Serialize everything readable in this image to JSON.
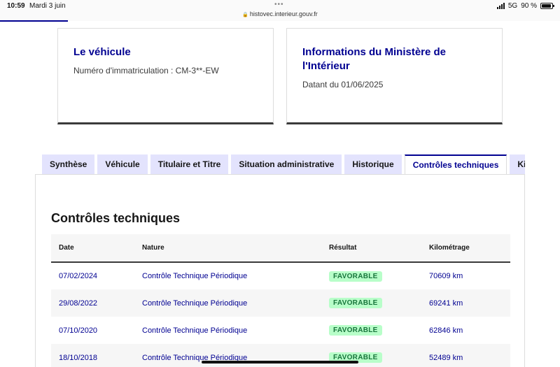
{
  "status_bar": {
    "time": "10:59",
    "date": "Mardi 3 juin",
    "url": "histovec.interieur.gouv.fr",
    "network": "5G",
    "battery": "90 %",
    "battery_level": 0.9
  },
  "cards": [
    {
      "title": "Le véhicule",
      "text": "Numéro d'immatriculation : CM-3**-EW"
    },
    {
      "title": "Informations du Ministère de l'Intérieur",
      "text": "Datant du 01/06/2025"
    }
  ],
  "tabs": [
    {
      "label": "Synthèse"
    },
    {
      "label": "Véhicule"
    },
    {
      "label": "Titulaire et Titre"
    },
    {
      "label": "Situation administrative"
    },
    {
      "label": "Historique"
    },
    {
      "label": "Contrôles techniques"
    },
    {
      "label": "Kilométrage"
    }
  ],
  "active_tab": "Contrôles techniques",
  "section": {
    "title": "Contrôles techniques",
    "headers": {
      "date": "Date",
      "nature": "Nature",
      "result": "Résultat",
      "mileage": "Kilométrage"
    },
    "rows": [
      {
        "date": "07/02/2024",
        "nature": "Contrôle Technique Périodique",
        "result": "FAVORABLE",
        "mileage": "70609 km"
      },
      {
        "date": "29/08/2022",
        "nature": "Contrôle Technique Périodique",
        "result": "FAVORABLE",
        "mileage": "69241 km"
      },
      {
        "date": "07/10/2020",
        "nature": "Contrôle Technique Périodique",
        "result": "FAVORABLE",
        "mileage": "62846 km"
      },
      {
        "date": "18/10/2018",
        "nature": "Contrôle Technique Périodique",
        "result": "FAVORABLE",
        "mileage": "52489 km"
      }
    ]
  },
  "colors": {
    "accent": "#000091",
    "tab_bg": "#e3e3fd",
    "badge_bg": "#b8fec9",
    "badge_text": "#18753c"
  }
}
